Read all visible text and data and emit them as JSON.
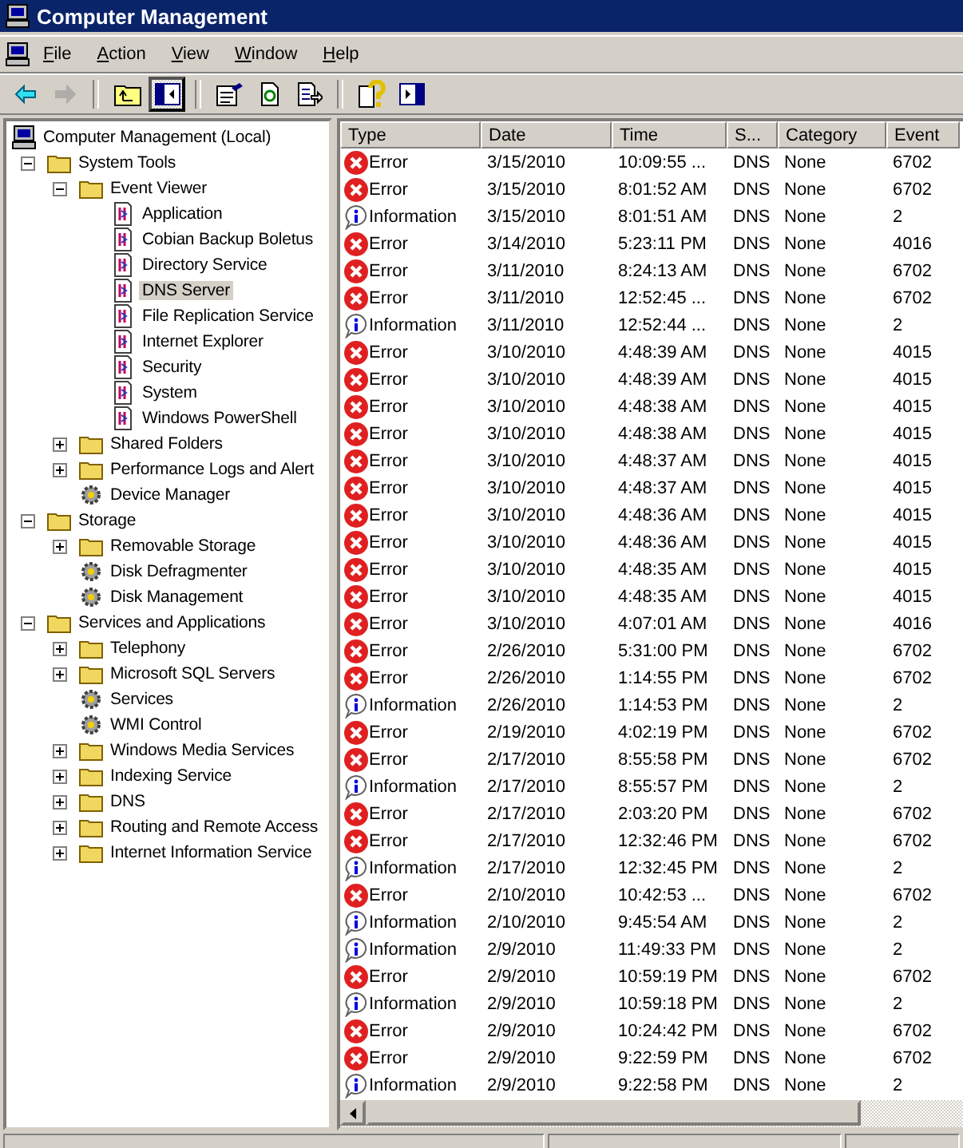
{
  "window": {
    "title": "Computer Management"
  },
  "menu": [
    "File",
    "Action",
    "View",
    "Window",
    "Help"
  ],
  "toolbar": [
    {
      "kind": "back",
      "disabled": false,
      "pressed": false
    },
    {
      "kind": "forward",
      "disabled": true,
      "pressed": false
    },
    {
      "kind": "sep"
    },
    {
      "kind": "up",
      "disabled": false,
      "pressed": false
    },
    {
      "kind": "tree",
      "disabled": false,
      "pressed": true
    },
    {
      "kind": "sep"
    },
    {
      "kind": "properties",
      "disabled": false,
      "pressed": false
    },
    {
      "kind": "refresh",
      "disabled": false,
      "pressed": false
    },
    {
      "kind": "export",
      "disabled": false,
      "pressed": false
    },
    {
      "kind": "sep"
    },
    {
      "kind": "help",
      "disabled": false,
      "pressed": false
    },
    {
      "kind": "pane",
      "disabled": false,
      "pressed": false
    }
  ],
  "tree": [
    {
      "label": "Computer Management (Local)",
      "selected": false,
      "children": [
        {
          "label": "System Tools",
          "expanded": true,
          "selected": false,
          "children": [
            {
              "label": "Event Viewer",
              "expanded": true,
              "selected": false,
              "children": [
                {
                  "label": "Application",
                  "selected": false
                },
                {
                  "label": "Cobian Backup Boletus",
                  "selected": false
                },
                {
                  "label": "Directory Service",
                  "selected": false
                },
                {
                  "label": "DNS Server",
                  "selected": true
                },
                {
                  "label": "File Replication Service",
                  "selected": false
                },
                {
                  "label": "Internet Explorer",
                  "selected": false
                },
                {
                  "label": "Security",
                  "selected": false
                },
                {
                  "label": "System",
                  "selected": false
                },
                {
                  "label": "Windows PowerShell",
                  "selected": false
                }
              ]
            },
            {
              "label": "Shared Folders",
              "expanded": false,
              "selected": false
            },
            {
              "label": "Performance Logs and Alert",
              "expanded": false,
              "selected": false
            },
            {
              "label": "Device Manager",
              "selected": false
            }
          ]
        },
        {
          "label": "Storage",
          "expanded": true,
          "selected": false,
          "children": [
            {
              "label": "Removable Storage",
              "expanded": false,
              "selected": false
            },
            {
              "label": "Disk Defragmenter",
              "selected": false
            },
            {
              "label": "Disk Management",
              "selected": false
            }
          ]
        },
        {
          "label": "Services and Applications",
          "expanded": true,
          "selected": false,
          "children": [
            {
              "label": "Telephony",
              "expanded": false,
              "selected": false
            },
            {
              "label": "Microsoft SQL Servers",
              "expanded": false,
              "selected": false
            },
            {
              "label": "Services",
              "selected": false
            },
            {
              "label": "WMI Control",
              "selected": false
            },
            {
              "label": "Windows Media Services",
              "expanded": false,
              "selected": false
            },
            {
              "label": "Indexing Service",
              "expanded": false,
              "selected": false
            },
            {
              "label": "DNS",
              "expanded": false,
              "selected": false
            },
            {
              "label": "Routing and Remote Access",
              "expanded": false,
              "selected": false
            },
            {
              "label": "Internet Information Service",
              "expanded": false,
              "selected": false
            }
          ]
        }
      ]
    }
  ],
  "table": {
    "columns": [
      "Type",
      "Date",
      "Time",
      "S...",
      "Category",
      "Event"
    ],
    "rows": [
      {
        "kind": "error",
        "type": "Error",
        "date": "3/15/2010",
        "time": "10:09:55 ...",
        "source": "DNS",
        "category": "None",
        "event": "6702"
      },
      {
        "kind": "error",
        "type": "Error",
        "date": "3/15/2010",
        "time": "8:01:52 AM",
        "source": "DNS",
        "category": "None",
        "event": "6702"
      },
      {
        "kind": "info",
        "type": "Information",
        "date": "3/15/2010",
        "time": "8:01:51 AM",
        "source": "DNS",
        "category": "None",
        "event": "2"
      },
      {
        "kind": "error",
        "type": "Error",
        "date": "3/14/2010",
        "time": "5:23:11 PM",
        "source": "DNS",
        "category": "None",
        "event": "4016"
      },
      {
        "kind": "error",
        "type": "Error",
        "date": "3/11/2010",
        "time": "8:24:13 AM",
        "source": "DNS",
        "category": "None",
        "event": "6702"
      },
      {
        "kind": "error",
        "type": "Error",
        "date": "3/11/2010",
        "time": "12:52:45 ...",
        "source": "DNS",
        "category": "None",
        "event": "6702"
      },
      {
        "kind": "info",
        "type": "Information",
        "date": "3/11/2010",
        "time": "12:52:44 ...",
        "source": "DNS",
        "category": "None",
        "event": "2"
      },
      {
        "kind": "error",
        "type": "Error",
        "date": "3/10/2010",
        "time": "4:48:39 AM",
        "source": "DNS",
        "category": "None",
        "event": "4015"
      },
      {
        "kind": "error",
        "type": "Error",
        "date": "3/10/2010",
        "time": "4:48:39 AM",
        "source": "DNS",
        "category": "None",
        "event": "4015"
      },
      {
        "kind": "error",
        "type": "Error",
        "date": "3/10/2010",
        "time": "4:48:38 AM",
        "source": "DNS",
        "category": "None",
        "event": "4015"
      },
      {
        "kind": "error",
        "type": "Error",
        "date": "3/10/2010",
        "time": "4:48:38 AM",
        "source": "DNS",
        "category": "None",
        "event": "4015"
      },
      {
        "kind": "error",
        "type": "Error",
        "date": "3/10/2010",
        "time": "4:48:37 AM",
        "source": "DNS",
        "category": "None",
        "event": "4015"
      },
      {
        "kind": "error",
        "type": "Error",
        "date": "3/10/2010",
        "time": "4:48:37 AM",
        "source": "DNS",
        "category": "None",
        "event": "4015"
      },
      {
        "kind": "error",
        "type": "Error",
        "date": "3/10/2010",
        "time": "4:48:36 AM",
        "source": "DNS",
        "category": "None",
        "event": "4015"
      },
      {
        "kind": "error",
        "type": "Error",
        "date": "3/10/2010",
        "time": "4:48:36 AM",
        "source": "DNS",
        "category": "None",
        "event": "4015"
      },
      {
        "kind": "error",
        "type": "Error",
        "date": "3/10/2010",
        "time": "4:48:35 AM",
        "source": "DNS",
        "category": "None",
        "event": "4015"
      },
      {
        "kind": "error",
        "type": "Error",
        "date": "3/10/2010",
        "time": "4:48:35 AM",
        "source": "DNS",
        "category": "None",
        "event": "4015"
      },
      {
        "kind": "error",
        "type": "Error",
        "date": "3/10/2010",
        "time": "4:07:01 AM",
        "source": "DNS",
        "category": "None",
        "event": "4016"
      },
      {
        "kind": "error",
        "type": "Error",
        "date": "2/26/2010",
        "time": "5:31:00 PM",
        "source": "DNS",
        "category": "None",
        "event": "6702"
      },
      {
        "kind": "error",
        "type": "Error",
        "date": "2/26/2010",
        "time": "1:14:55 PM",
        "source": "DNS",
        "category": "None",
        "event": "6702"
      },
      {
        "kind": "info",
        "type": "Information",
        "date": "2/26/2010",
        "time": "1:14:53 PM",
        "source": "DNS",
        "category": "None",
        "event": "2"
      },
      {
        "kind": "error",
        "type": "Error",
        "date": "2/19/2010",
        "time": "4:02:19 PM",
        "source": "DNS",
        "category": "None",
        "event": "6702"
      },
      {
        "kind": "error",
        "type": "Error",
        "date": "2/17/2010",
        "time": "8:55:58 PM",
        "source": "DNS",
        "category": "None",
        "event": "6702"
      },
      {
        "kind": "info",
        "type": "Information",
        "date": "2/17/2010",
        "time": "8:55:57 PM",
        "source": "DNS",
        "category": "None",
        "event": "2"
      },
      {
        "kind": "error",
        "type": "Error",
        "date": "2/17/2010",
        "time": "2:03:20 PM",
        "source": "DNS",
        "category": "None",
        "event": "6702"
      },
      {
        "kind": "error",
        "type": "Error",
        "date": "2/17/2010",
        "time": "12:32:46 PM",
        "source": "DNS",
        "category": "None",
        "event": "6702"
      },
      {
        "kind": "info",
        "type": "Information",
        "date": "2/17/2010",
        "time": "12:32:45 PM",
        "source": "DNS",
        "category": "None",
        "event": "2"
      },
      {
        "kind": "error",
        "type": "Error",
        "date": "2/10/2010",
        "time": "10:42:53 ...",
        "source": "DNS",
        "category": "None",
        "event": "6702"
      },
      {
        "kind": "info",
        "type": "Information",
        "date": "2/10/2010",
        "time": "9:45:54 AM",
        "source": "DNS",
        "category": "None",
        "event": "2"
      },
      {
        "kind": "info",
        "type": "Information",
        "date": "2/9/2010",
        "time": "11:49:33 PM",
        "source": "DNS",
        "category": "None",
        "event": "2"
      },
      {
        "kind": "error",
        "type": "Error",
        "date": "2/9/2010",
        "time": "10:59:19 PM",
        "source": "DNS",
        "category": "None",
        "event": "6702"
      },
      {
        "kind": "info",
        "type": "Information",
        "date": "2/9/2010",
        "time": "10:59:18 PM",
        "source": "DNS",
        "category": "None",
        "event": "2"
      },
      {
        "kind": "error",
        "type": "Error",
        "date": "2/9/2010",
        "time": "10:24:42 PM",
        "source": "DNS",
        "category": "None",
        "event": "6702"
      },
      {
        "kind": "error",
        "type": "Error",
        "date": "2/9/2010",
        "time": "9:22:59 PM",
        "source": "DNS",
        "category": "None",
        "event": "6702"
      },
      {
        "kind": "info",
        "type": "Information",
        "date": "2/9/2010",
        "time": "9:22:58 PM",
        "source": "DNS",
        "category": "None",
        "event": "2"
      }
    ]
  }
}
